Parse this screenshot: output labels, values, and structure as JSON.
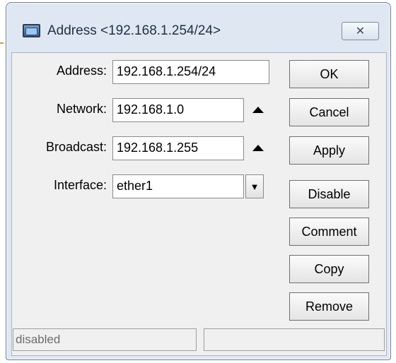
{
  "window": {
    "title": "Address <192.168.1.254/24>",
    "close_glyph": "✕"
  },
  "form": {
    "address_label": "Address:",
    "address_value": "192.168.1.254/24",
    "network_label": "Network:",
    "network_value": "192.168.1.0",
    "broadcast_label": "Broadcast:",
    "broadcast_value": "192.168.1.255",
    "interface_label": "Interface:",
    "interface_value": "ether1",
    "dropdown_glyph": "▼"
  },
  "buttons": {
    "ok": "OK",
    "cancel": "Cancel",
    "apply": "Apply",
    "disable": "Disable",
    "comment": "Comment",
    "copy": "Copy",
    "remove": "Remove"
  },
  "status": {
    "left": "disabled",
    "right": ""
  },
  "icons": [
    "window-icon",
    "close-icon",
    "collapse-up-icon",
    "dropdown-icon"
  ]
}
